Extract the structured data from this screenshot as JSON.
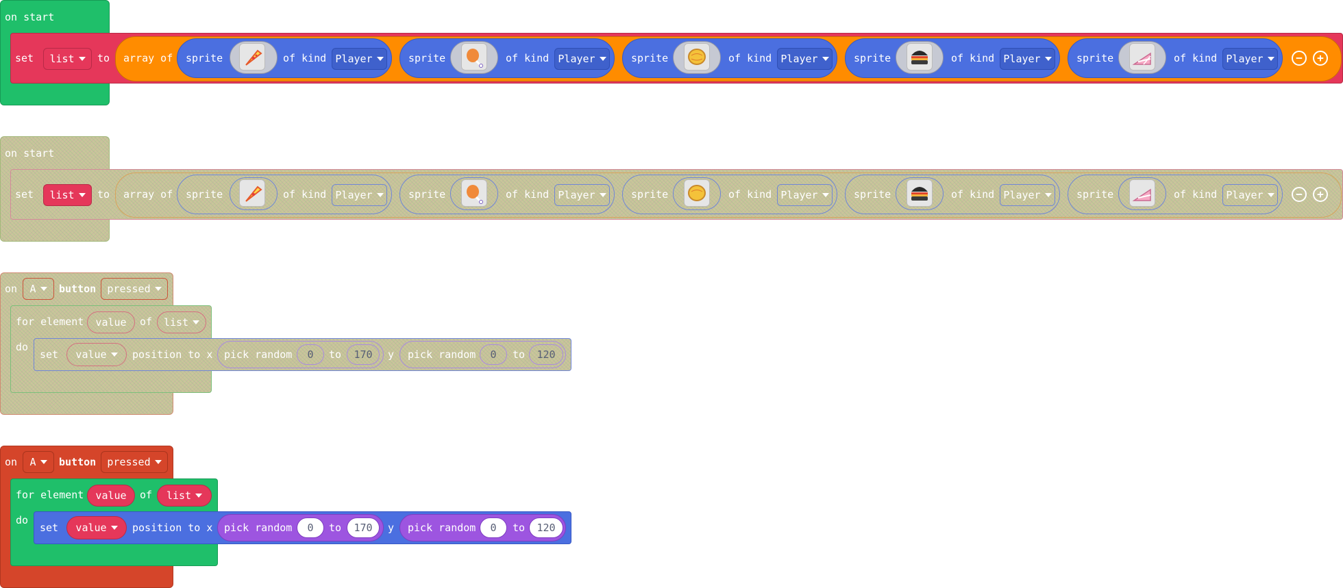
{
  "colors": {
    "green": "#1fbf6a",
    "variables": "#e5375a",
    "arrays": "#ff8c00",
    "sprites": "#4b6fe0",
    "math": "#9d55e0",
    "controller": "#d5452a",
    "disabled": "#c9c69a"
  },
  "kind_value": "Player",
  "blocks": {
    "on_start_1": {
      "hat": "on start",
      "set_label": "set",
      "var_name": "list",
      "to_label": "to",
      "array_label": "array of",
      "sprite_label": "sprite",
      "kind_label": "of kind",
      "sprites": [
        {
          "image": "pizza-slice-icon"
        },
        {
          "image": "chicken-leg-icon"
        },
        {
          "image": "lemon-pie-icon"
        },
        {
          "image": "burger-icon"
        },
        {
          "image": "cake-slice-icon"
        }
      ],
      "remove_glyph": "−",
      "add_glyph": "+"
    },
    "on_start_2": {
      "hat": "on start",
      "set_label": "set",
      "var_name": "list",
      "to_label": "to",
      "array_label": "array of",
      "sprite_label": "sprite",
      "kind_label": "of kind",
      "remove_glyph": "−",
      "add_glyph": "+"
    },
    "button_1": {
      "on_label": "on",
      "button_value": "A",
      "button_label": "button",
      "event_value": "pressed",
      "for_label": "for element",
      "element_var": "value",
      "of_label": "of",
      "list_var": "list",
      "do_label": "do",
      "set_label": "set",
      "sprite_var": "value",
      "position_label": "position to x",
      "pick_label": "pick random",
      "x_from": "0",
      "to_label": "to",
      "x_to": "170",
      "y_label": "y",
      "y_from": "0",
      "y_to": "120"
    },
    "button_2": {
      "on_label": "on",
      "button_value": "A",
      "button_label": "button",
      "event_value": "pressed",
      "for_label": "for element",
      "element_var": "value",
      "of_label": "of",
      "list_var": "list",
      "do_label": "do",
      "set_label": "set",
      "sprite_var": "value",
      "position_label": "position to x",
      "pick_label": "pick random",
      "x_from": "0",
      "to_label": "to",
      "x_to": "170",
      "y_label": "y",
      "y_from": "0",
      "y_to": "120"
    }
  }
}
